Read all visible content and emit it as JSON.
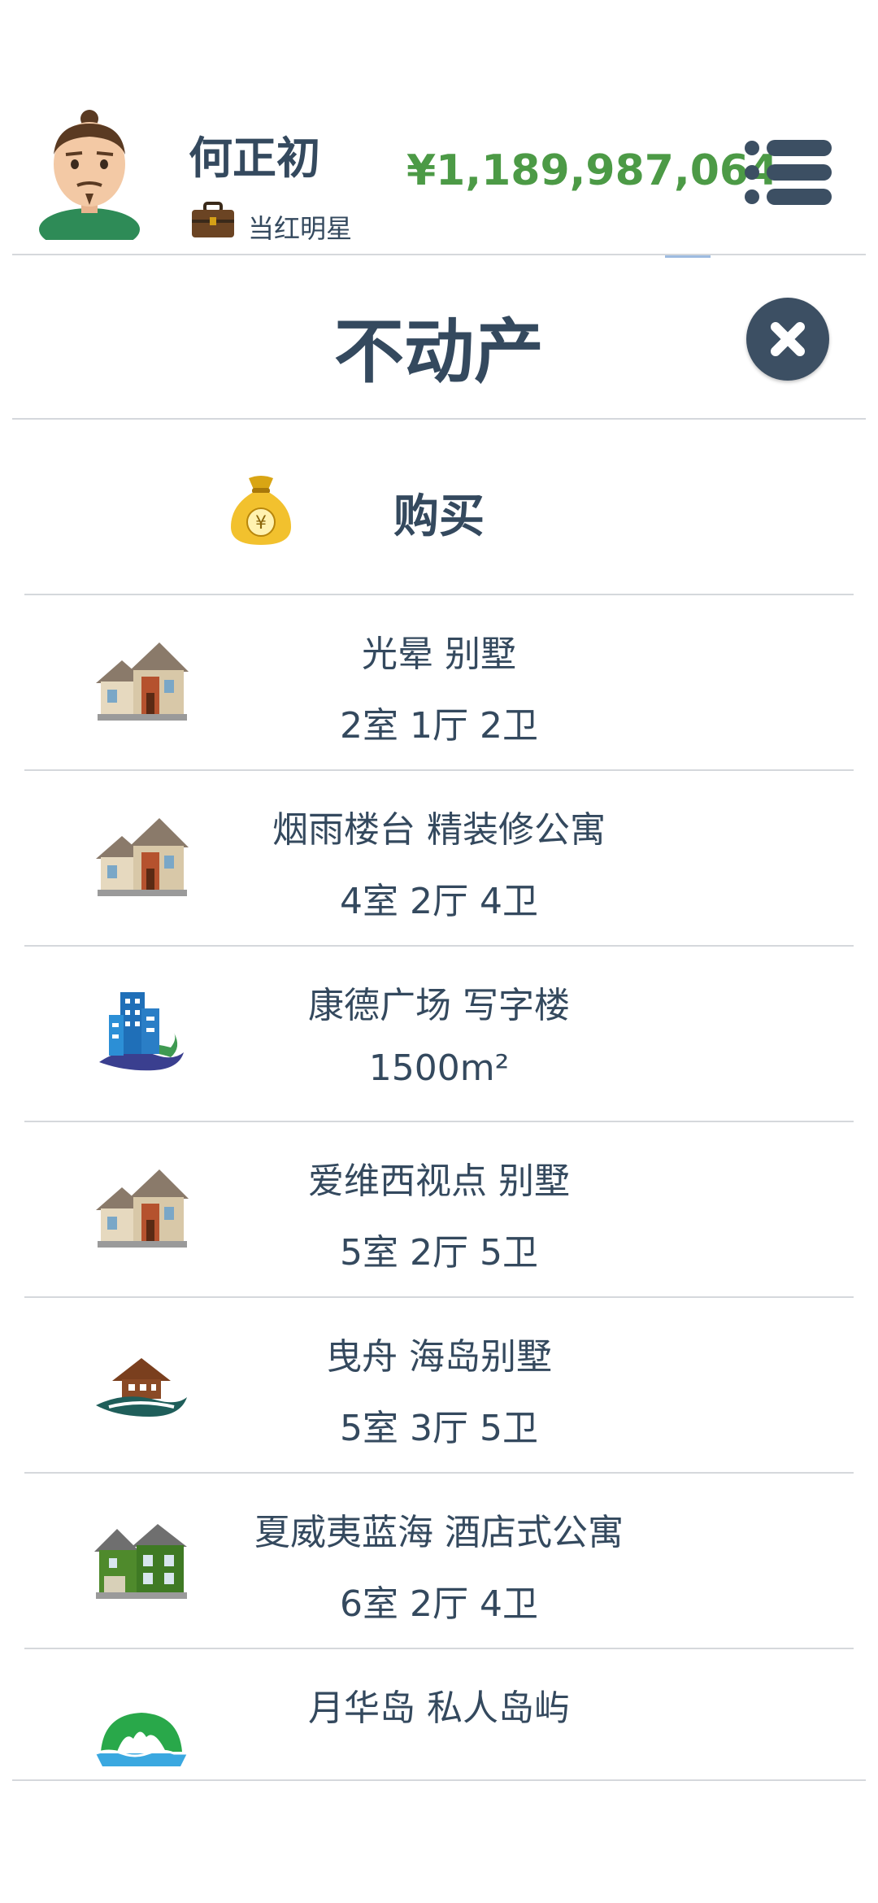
{
  "header": {
    "player_name": "何正初",
    "job": "当红明星",
    "money": "¥1,189,987,064",
    "icons": {
      "avatar": "avatar-man-icon",
      "job": "briefcase-icon",
      "menu": "list-menu-icon"
    }
  },
  "page": {
    "title": "不动产",
    "close_icon": "close-icon"
  },
  "buy": {
    "label": "购买",
    "icon": "money-bag-icon"
  },
  "properties": [
    {
      "name": "光晕 别墅",
      "detail": "2室 1厅 2卫",
      "icon": "house-icon"
    },
    {
      "name": "烟雨楼台 精装修公寓",
      "detail": "4室 2厅 4卫",
      "icon": "house-icon"
    },
    {
      "name": "康德广场 写字楼",
      "detail": "1500m²",
      "icon": "office-building-icon"
    },
    {
      "name": "爱维西视点 别墅",
      "detail": "5室 2厅 5卫",
      "icon": "house-icon"
    },
    {
      "name": "曳舟 海岛别墅",
      "detail": "5室 3厅 5卫",
      "icon": "island-villa-icon"
    },
    {
      "name": "夏威夷蓝海 酒店式公寓",
      "detail": "6室 2厅 4卫",
      "icon": "green-house-icon"
    },
    {
      "name": "月华岛 私人岛屿",
      "detail": "",
      "icon": "private-island-icon"
    }
  ],
  "colors": {
    "text": "#34495e",
    "money": "#4c9a46",
    "close_button": "#3c4f63",
    "divider": "#d5d8dc"
  }
}
